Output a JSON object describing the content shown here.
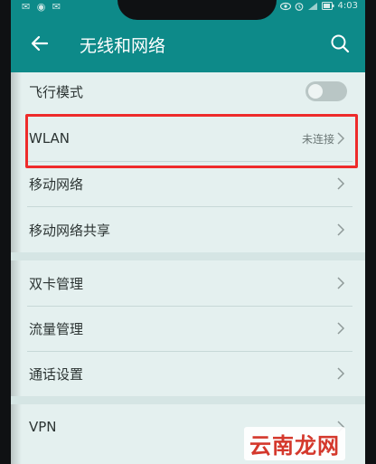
{
  "status_bar": {
    "left_icons": "✉ ◉ ✉",
    "time": "4:03"
  },
  "header": {
    "title": "无线和网络"
  },
  "items": [
    {
      "label": "飞行模式",
      "type": "toggle",
      "on": false
    },
    {
      "label": "WLAN",
      "value": "未连接",
      "type": "chevron",
      "highlighted": true
    },
    {
      "label": "移动网络",
      "type": "chevron"
    },
    {
      "label": "移动网络共享",
      "type": "chevron"
    },
    {
      "label": "双卡管理",
      "type": "chevron"
    },
    {
      "label": "流量管理",
      "type": "chevron"
    },
    {
      "label": "通话设置",
      "type": "chevron"
    },
    {
      "label": "VPN",
      "type": "chevron"
    }
  ],
  "watermark": "云南龙网",
  "colors": {
    "header": "#0d8a89",
    "background": "#e4f0ef",
    "highlight": "#ee2b2b"
  }
}
